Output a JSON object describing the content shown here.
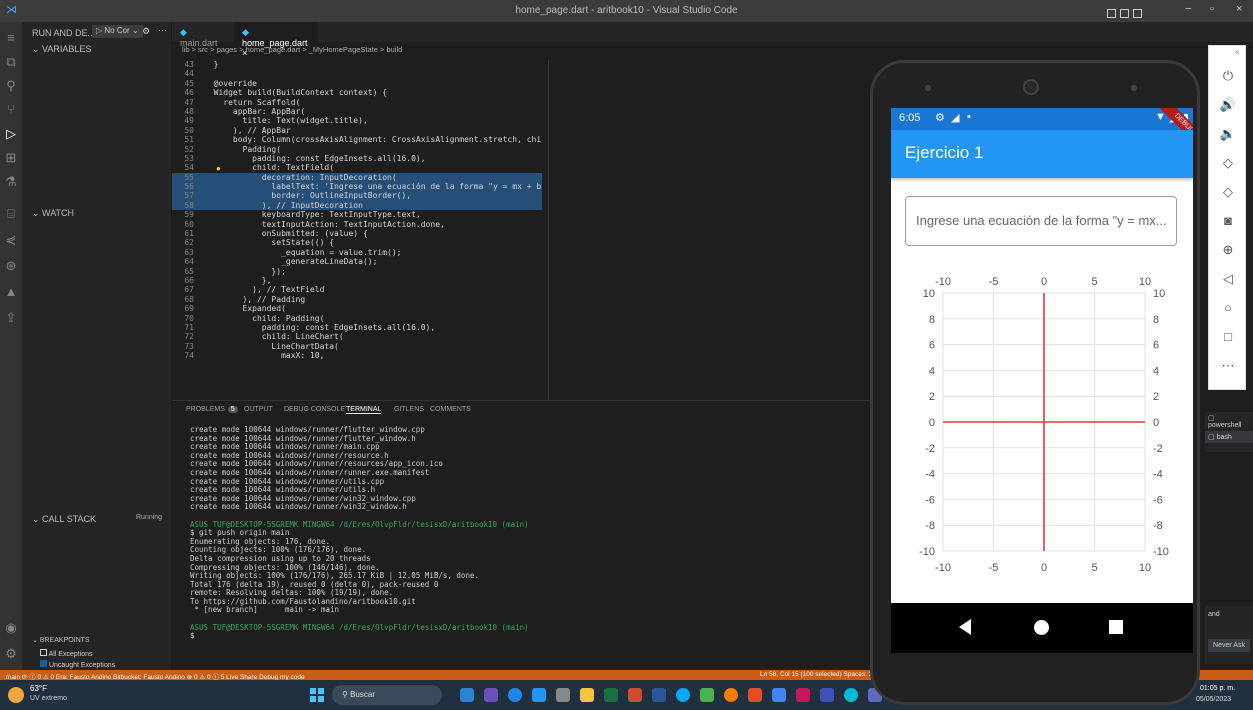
{
  "window": {
    "title": "home_page.dart - aritbook10 - Visual Studio Code"
  },
  "sidebar": {
    "run_label": "RUN AND DE...",
    "config_label": "No Cor",
    "variables": "VARIABLES",
    "watch": "WATCH",
    "call_stack": "CALL STACK",
    "call_stack_status": "Running",
    "breakpoints": "BREAKPOINTS",
    "bp_all": "All Exceptions",
    "bp_uncaught": "Uncaught Exceptions"
  },
  "tabs": [
    {
      "label": "main.dart"
    },
    {
      "label": "home_page.dart"
    }
  ],
  "breadcrumb": "lib > src > pages > home_page.dart > _MyHomePageState > build",
  "code": [
    {
      "n": "43",
      "t": "  }"
    },
    {
      "n": "44",
      "t": ""
    },
    {
      "n": "45",
      "t": "  @override"
    },
    {
      "n": "46",
      "t": "  Widget build(BuildContext context) {"
    },
    {
      "n": "47",
      "t": "    return Scaffold("
    },
    {
      "n": "48",
      "t": "      appBar: AppBar("
    },
    {
      "n": "49",
      "t": "        title: Text(widget.title),"
    },
    {
      "n": "50",
      "t": "      ), // AppBar"
    },
    {
      "n": "51",
      "t": "      body: Column(crossAxisAlignment: CrossAxisAlignment.stretch, children: ["
    },
    {
      "n": "52",
      "t": "        Padding("
    },
    {
      "n": "53",
      "t": "          padding: const EdgeInsets.all(16.0),"
    },
    {
      "n": "54",
      "t": "          child: TextField("
    },
    {
      "n": "55",
      "t": "            decoration: InputDecoration("
    },
    {
      "n": "56",
      "t": "              labelText: 'Ingrese una ecuación de la forma \"y = mx + b\"',"
    },
    {
      "n": "57",
      "t": "              border: OutlineInputBorder(),"
    },
    {
      "n": "58",
      "t": "            ), // InputDecoration"
    },
    {
      "n": "59",
      "t": "            keyboardType: TextInputType.text,"
    },
    {
      "n": "60",
      "t": "            textInputAction: TextInputAction.done,"
    },
    {
      "n": "61",
      "t": "            onSubmitted: (value) {"
    },
    {
      "n": "62",
      "t": "              setState(() {"
    },
    {
      "n": "63",
      "t": "                _equation = value.trim();"
    },
    {
      "n": "64",
      "t": "                _generateLineData();"
    },
    {
      "n": "65",
      "t": "              });"
    },
    {
      "n": "66",
      "t": "            },"
    },
    {
      "n": "67",
      "t": "          ), // TextField"
    },
    {
      "n": "68",
      "t": "        ), // Padding"
    },
    {
      "n": "69",
      "t": "        Expanded("
    },
    {
      "n": "70",
      "t": "          child: Padding("
    },
    {
      "n": "71",
      "t": "            padding: const EdgeInsets.all(16.0),"
    },
    {
      "n": "72",
      "t": "            child: LineChart("
    },
    {
      "n": "73",
      "t": "              LineChartData("
    },
    {
      "n": "74",
      "t": "                maxX: 10,"
    }
  ],
  "panel_tabs": [
    "PROBLEMS",
    "OUTPUT",
    "DEBUG CONSOLE",
    "TERMINAL",
    "GITLENS",
    "COMMENTS"
  ],
  "problems_count": "5",
  "terminal": [
    "create mode 100644 windows/runner/flutter_window.cpp",
    "create mode 100644 windows/runner/flutter_window.h",
    "create mode 100644 windows/runner/main.cpp",
    "create mode 100644 windows/runner/resource.h",
    "create mode 100644 windows/runner/resources/app_icon.ico",
    "create mode 100644 windows/runner/runner.exe.manifest",
    "create mode 100644 windows/runner/utils.cpp",
    "create mode 100644 windows/runner/utils.h",
    "create mode 100644 windows/runner/win32_window.cpp",
    "create mode 100644 windows/runner/win32_window.h",
    "",
    "ASUS TUF@DESKTOP-5SGREMK MINGW64 /d/Eres/OlvpFldr/tesisxD/aritbook10 (main)",
    "$ git push origin main",
    "Enumerating objects: 176, done.",
    "Counting objects: 100% (176/176), done.",
    "Delta compression using up to 20 threads",
    "Compressing objects: 100% (146/146), done.",
    "Writing objects: 100% (176/176), 265.17 KiB | 12.05 MiB/s, done.",
    "Total 176 (delta 19), reused 0 (delta 0), pack-reused 0",
    "remote: Resolving deltas: 100% (19/19), done.",
    "To https://github.com/Faustolandino/aritbook10.git",
    " * [new branch]      main -> main",
    "",
    "ASUS TUF@DESKTOP-5SGREMK MINGW64 /d/Eres/OlvpFldr/tesisxD/aritbook10 (main)",
    "$ "
  ],
  "terminal_list": [
    "powershell",
    "bash"
  ],
  "statusbar": {
    "left": "main ⟳  ⓘ 0 ⚠ 0  Era: Fausto Andino   Bitbucket: Fausto Andino   ⊗ 0 ⚠ 0 ⓘ 5   Live Share   Debug my code",
    "right": "Ln 58, Col 15 (100 selected)  Spaces: 2"
  },
  "notification": {
    "text": "and",
    "button": "Never Ask"
  },
  "taskbar": {
    "weather_temp": "63°F",
    "weather_desc": "UV extremo",
    "search": "Buscar",
    "time": "01:05 p. m.",
    "date": "05/05/2023"
  },
  "phone": {
    "status_time": "6:05",
    "debug_badge": "DEBUG",
    "appbar_title": "Ejercicio 1",
    "input_label": "Ingrese una ecuación de la forma \"y = mx...",
    "appbar_color": "#2196f3",
    "line_color": "#e53935"
  },
  "chart_data": {
    "type": "line",
    "title": "",
    "xlabel": "",
    "ylabel": "",
    "xlim": [
      -10,
      10
    ],
    "ylim": [
      -10,
      10
    ],
    "x_ticks": [
      -10,
      -5,
      0,
      5,
      10
    ],
    "y_ticks": [
      -10,
      -8,
      -6,
      -4,
      -2,
      0,
      2,
      4,
      6,
      8,
      10
    ],
    "grid": true,
    "series": [
      {
        "x": [
          -10,
          10
        ],
        "y": [
          0,
          0
        ]
      },
      {
        "x": [
          0,
          0
        ],
        "y": [
          -10,
          10
        ]
      }
    ]
  },
  "emulator_toolbar": [
    "power-icon",
    "volume-up-icon",
    "volume-down-icon",
    "rotate-left-icon",
    "rotate-right-icon",
    "camera-icon",
    "zoom-icon",
    "back-icon",
    "home-icon",
    "overview-icon",
    "more-icon"
  ],
  "emulator_glyphs": [
    "⏻",
    "🔊",
    "🔉",
    "◇",
    "◇",
    "◙",
    "⊕",
    "◁",
    "○",
    "□",
    "⋯"
  ]
}
